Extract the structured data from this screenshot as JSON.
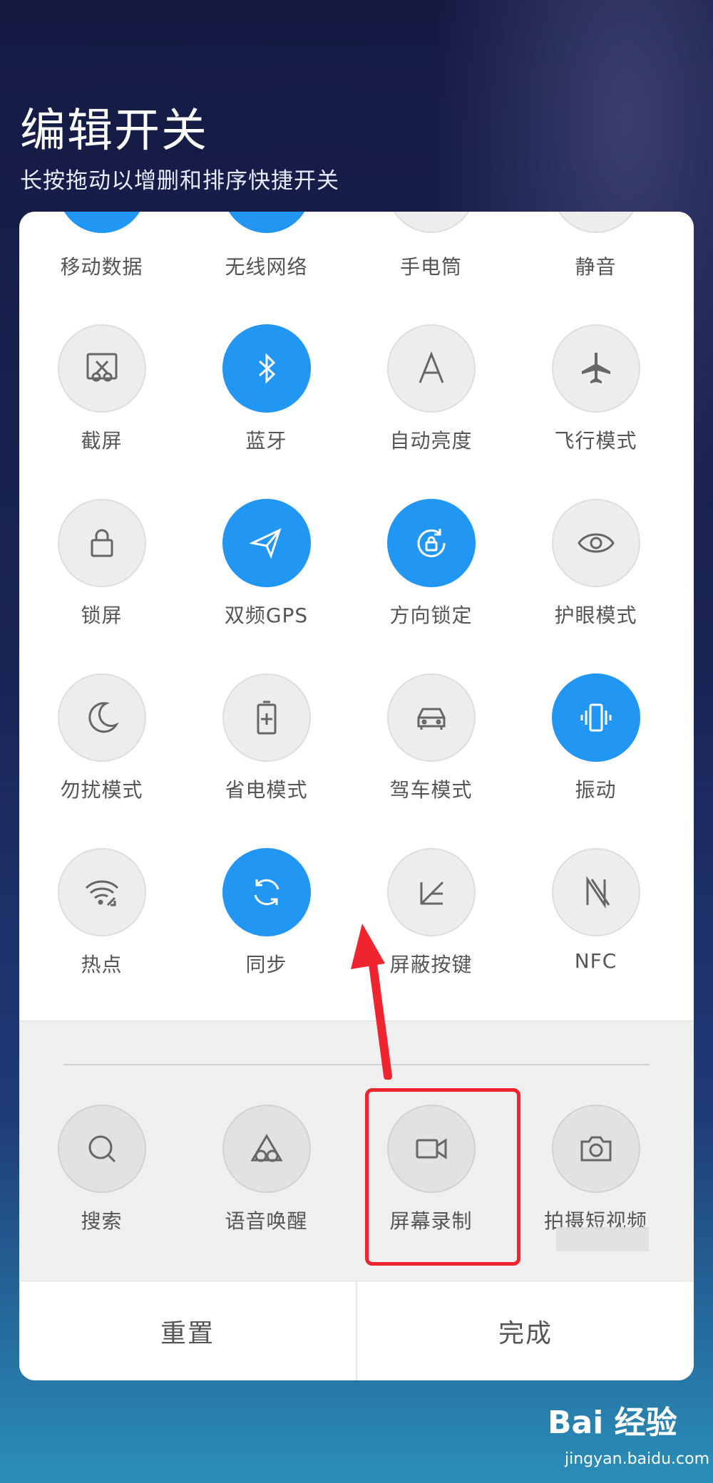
{
  "header": {
    "title": "编辑开关",
    "subtitle": "长按拖动以增删和排序快捷开关"
  },
  "active_tiles": {
    "row0": [
      "移动数据",
      "无线网络",
      "手电筒",
      "静音"
    ],
    "row1": [
      {
        "label": "截屏",
        "icon": "screenshot-icon",
        "on": false
      },
      {
        "label": "蓝牙",
        "icon": "bluetooth-icon",
        "on": true
      },
      {
        "label": "自动亮度",
        "icon": "auto-brightness-icon",
        "on": false
      },
      {
        "label": "飞行模式",
        "icon": "airplane-icon",
        "on": false
      }
    ],
    "row2": [
      {
        "label": "锁屏",
        "icon": "lock-icon",
        "on": false
      },
      {
        "label": "双频GPS",
        "icon": "gps-icon",
        "on": true
      },
      {
        "label": "方向锁定",
        "icon": "rotation-lock-icon",
        "on": true
      },
      {
        "label": "护眼模式",
        "icon": "eye-icon",
        "on": false
      }
    ],
    "row3": [
      {
        "label": "勿扰模式",
        "icon": "moon-icon",
        "on": false
      },
      {
        "label": "省电模式",
        "icon": "battery-saver-icon",
        "on": false
      },
      {
        "label": "驾车模式",
        "icon": "car-icon",
        "on": false
      },
      {
        "label": "振动",
        "icon": "vibrate-icon",
        "on": true
      }
    ],
    "row4": [
      {
        "label": "热点",
        "icon": "hotspot-icon",
        "on": false
      },
      {
        "label": "同步",
        "icon": "sync-icon",
        "on": true
      },
      {
        "label": "屏蔽按键",
        "icon": "key-block-icon",
        "on": false
      },
      {
        "label": "NFC",
        "icon": "nfc-icon",
        "on": false
      }
    ]
  },
  "inactive_tiles": [
    {
      "label": "搜索",
      "icon": "search-icon"
    },
    {
      "label": "语音唤醒",
      "icon": "voice-wake-icon"
    },
    {
      "label": "屏幕录制",
      "icon": "screen-record-icon"
    },
    {
      "label": "拍摄短视频",
      "icon": "camera-icon"
    }
  ],
  "footer": {
    "reset_label": "重置",
    "done_label": "完成"
  },
  "watermark": {
    "brand": "Bai 经验",
    "url": "jingyan.baidu.com"
  },
  "colors": {
    "accent": "#2196f3",
    "annotation": "#f0242f"
  }
}
